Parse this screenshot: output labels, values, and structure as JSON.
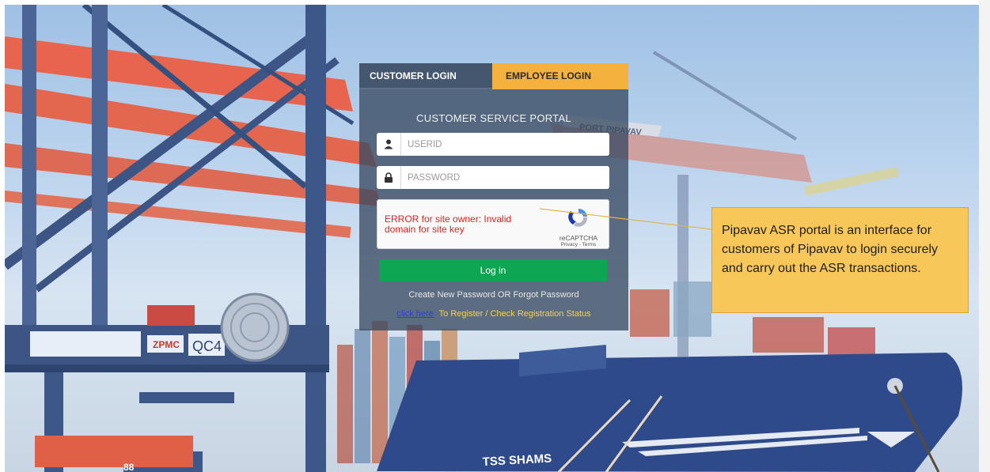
{
  "tabs": {
    "customer": "CUSTOMER LOGIN",
    "employee": "EMPLOYEE LOGIN"
  },
  "portal_title": "CUSTOMER SERVICE PORTAL",
  "fields": {
    "userid_placeholder": "USERID",
    "password_placeholder": "PASSWORD"
  },
  "recaptcha": {
    "error": "ERROR for site owner: Invalid domain for site key",
    "brand": "reCAPTCHA",
    "links": "Privacy - Terms"
  },
  "login_button": "Log in",
  "forgot_link": "Create New Password OR Forgot Password",
  "register": {
    "click_here": "click here",
    "text": "To Register / Check Registration Status"
  },
  "callout_text": "Pipavav ASR portal is an interface for customers of Pipavav to login securely and carry out the ASR transactions.",
  "background": {
    "sign_port": "PORT PIPAVAV",
    "ship_name": "TSS SHAMS",
    "crane_label": "QC4",
    "crane_brand": "ZPMC",
    "truck_number": "88"
  },
  "colors": {
    "panel": "#3a4a62",
    "employee_tab": "#f4b13e",
    "login_button": "#0fa653",
    "callout": "#f8c75a",
    "error_text": "#e02121"
  }
}
